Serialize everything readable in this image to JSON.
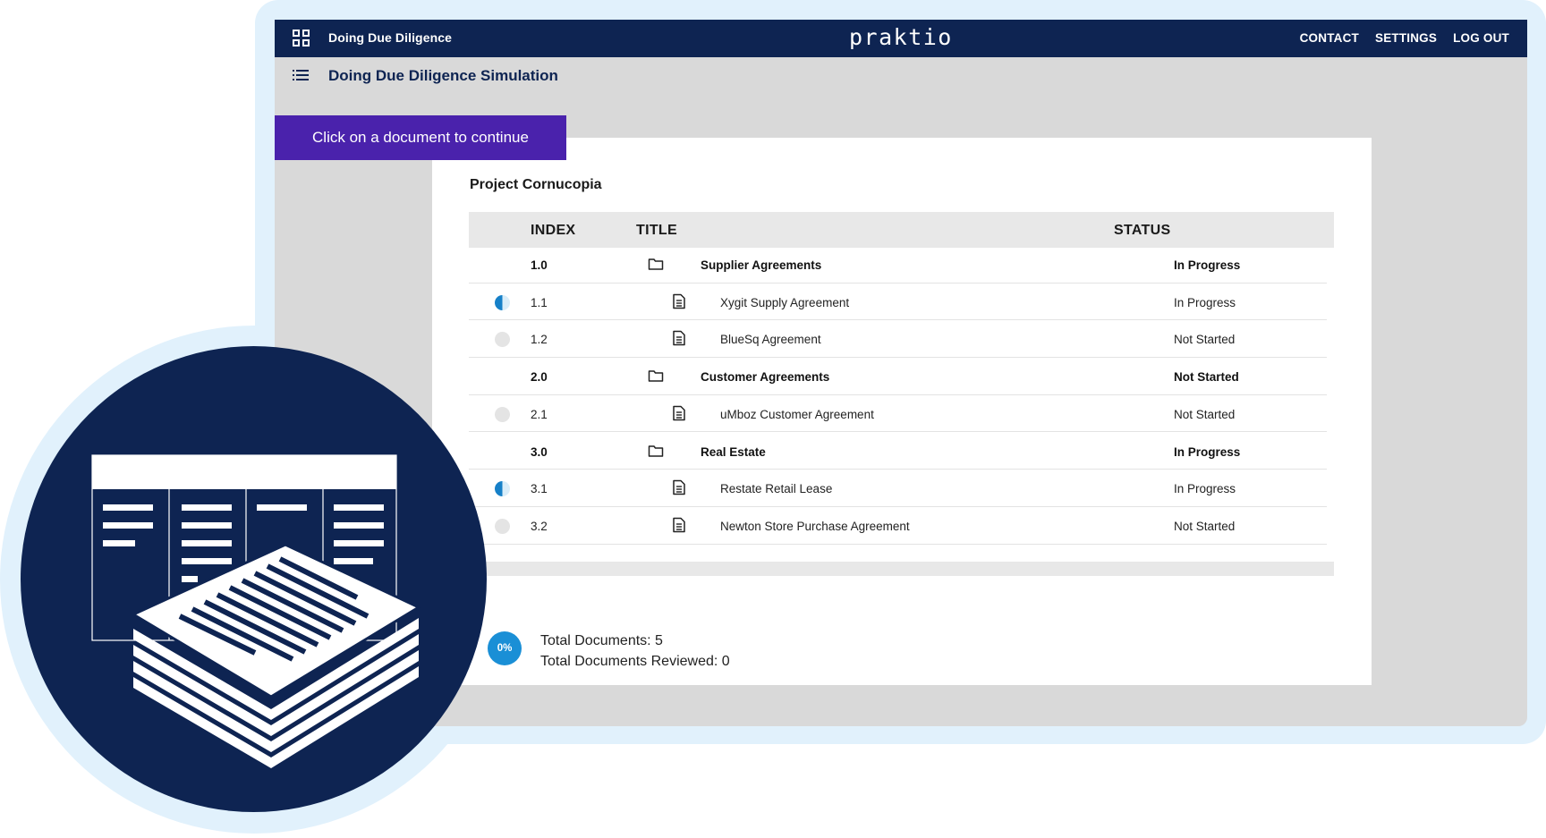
{
  "app": {
    "name": "Doing Due Diligence",
    "brand": "praktio",
    "nav": [
      "CONTACT",
      "SETTINGS",
      "LOG OUT"
    ],
    "simulation_title": "Doing Due Diligence Simulation"
  },
  "cta": {
    "label": "Click on a document to continue"
  },
  "project": {
    "title": "Project Cornucopia",
    "columns": {
      "index": "INDEX",
      "title": "TITLE",
      "status": "STATUS"
    },
    "rows": [
      {
        "type": "folder",
        "index": "1.0",
        "title": "Supplier Agreements",
        "status": "In Progress"
      },
      {
        "type": "document",
        "index": "1.1",
        "title": "Xygit Supply Agreement",
        "status": "In Progress",
        "indicator": "half"
      },
      {
        "type": "document",
        "index": "1.2",
        "title": "BlueSq Agreement",
        "status": "Not Started",
        "indicator": "empty"
      },
      {
        "type": "folder",
        "index": "2.0",
        "title": "Customer Agreements",
        "status": "Not Started"
      },
      {
        "type": "document",
        "index": "2.1",
        "title": "uMboz Customer Agreement",
        "status": "Not Started",
        "indicator": "empty"
      },
      {
        "type": "folder",
        "index": "3.0",
        "title": "Real Estate",
        "status": "In Progress"
      },
      {
        "type": "document",
        "index": "3.1",
        "title": "Restate Retail Lease",
        "status": "In Progress",
        "indicator": "half"
      },
      {
        "type": "document",
        "index": "3.2",
        "title": "Newton Store Purchase Agreement",
        "status": "Not Started",
        "indicator": "empty"
      }
    ]
  },
  "summary": {
    "percent": "0%",
    "total_documents": "Total Documents: 5",
    "total_reviewed": "Total Documents Reviewed: 0"
  },
  "colors": {
    "navy": "#0e2452",
    "cta_purple": "#4a22ac",
    "progress_blue": "#1a8fd6",
    "frame_light_blue": "#e1f1fc"
  }
}
